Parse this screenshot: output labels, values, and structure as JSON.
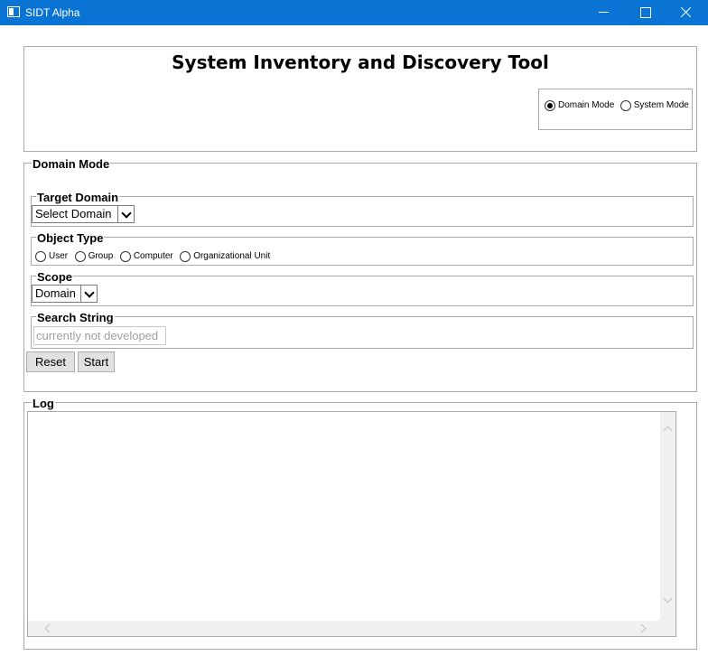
{
  "window": {
    "title": "SIDT Alpha",
    "icon": "window-app-icon"
  },
  "header": {
    "title": "System Inventory and Discovery Tool",
    "modes": [
      {
        "label": "Domain Mode",
        "checked": true
      },
      {
        "label": "System Mode",
        "checked": false
      }
    ]
  },
  "domain": {
    "legend": "Domain Mode",
    "target": {
      "legend": "Target Domain",
      "selected": "Select Domain"
    },
    "object_type": {
      "legend": "Object Type",
      "options": [
        {
          "label": "User",
          "checked": false
        },
        {
          "label": "Group",
          "checked": false
        },
        {
          "label": "Computer",
          "checked": false
        },
        {
          "label": "Organizational Unit",
          "checked": false
        }
      ]
    },
    "scope": {
      "legend": "Scope",
      "selected": "Domain"
    },
    "search": {
      "legend": "Search String",
      "placeholder": "currently not developed",
      "value": ""
    },
    "reset_label": "Reset",
    "start_label": "Start"
  },
  "log": {
    "legend": "Log",
    "content": ""
  }
}
